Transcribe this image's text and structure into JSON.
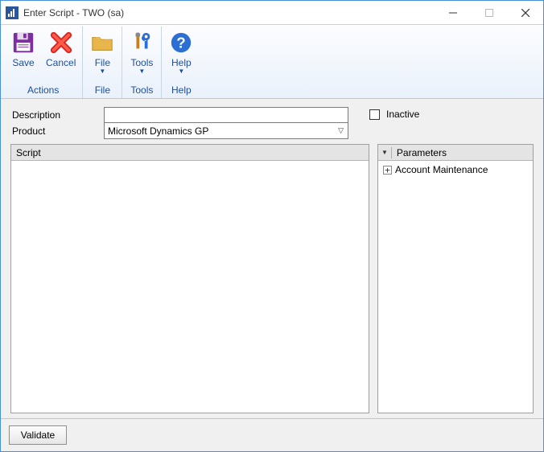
{
  "window": {
    "title": "Enter Script  -  TWO (sa)"
  },
  "ribbon": {
    "groups": [
      {
        "label": "Actions",
        "items": [
          {
            "label": "Save",
            "icon": "save",
            "dropdown": false
          },
          {
            "label": "Cancel",
            "icon": "cancel",
            "dropdown": false
          }
        ]
      },
      {
        "label": "File",
        "items": [
          {
            "label": "File",
            "icon": "folder",
            "dropdown": true
          }
        ]
      },
      {
        "label": "Tools",
        "items": [
          {
            "label": "Tools",
            "icon": "tools",
            "dropdown": true
          }
        ]
      },
      {
        "label": "Help",
        "items": [
          {
            "label": "Help",
            "icon": "help",
            "dropdown": true
          }
        ]
      }
    ]
  },
  "form": {
    "description_label": "Description",
    "description_value": "",
    "product_label": "Product",
    "product_value": "Microsoft Dynamics GP",
    "inactive_label": "Inactive",
    "inactive_checked": false
  },
  "script": {
    "header": "Script",
    "content": ""
  },
  "parameters": {
    "header": "Parameters",
    "tree": [
      {
        "label": "Account Maintenance",
        "expanded": false
      }
    ]
  },
  "footer": {
    "validate_label": "Validate"
  }
}
